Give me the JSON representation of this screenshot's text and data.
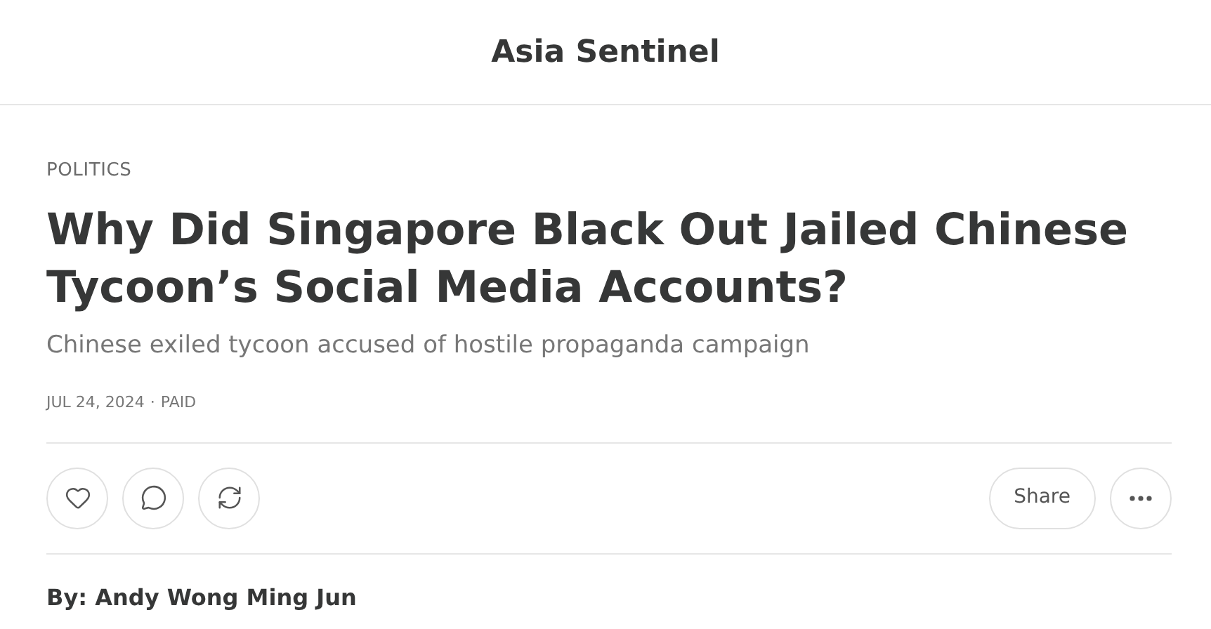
{
  "header": {
    "title": "Asia Sentinel"
  },
  "article": {
    "category": "POLITICS",
    "title": "Why Did Singapore Black Out Jailed Chinese Tycoon’s Social Media Accounts?",
    "subtitle": "Chinese exiled tycoon accused of hostile propaganda campaign",
    "date": "JUL 24, 2024",
    "separator": "·",
    "access": "PAID"
  },
  "actions": {
    "like": {
      "selected": false
    },
    "share_label": "Share"
  },
  "byline": "By: Andy Wong Ming Jun"
}
